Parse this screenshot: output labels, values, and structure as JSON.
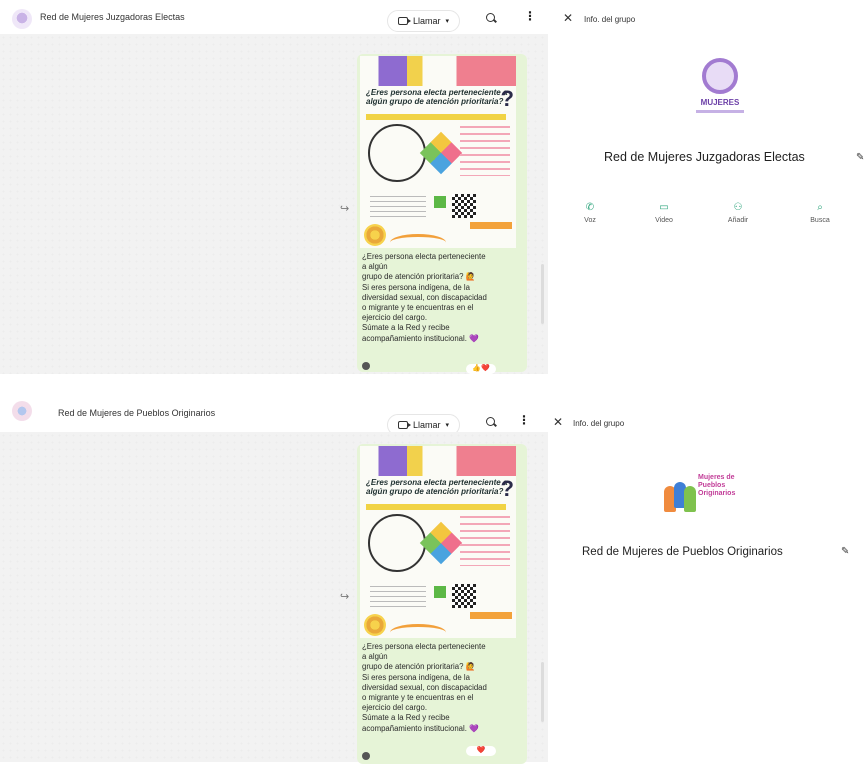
{
  "colors": {
    "accent": "#2aa37a",
    "bubble": "#e6f4d7",
    "chat_bg": "#f2f2f2"
  },
  "screens": [
    {
      "header": {
        "group_name": "Red de Mujeres Juzgadoras Electas",
        "call_label": "Llamar",
        "info_title": "Info. del grupo"
      },
      "message": {
        "poster_title": "¿Eres persona electa perteneciente a algún grupo de atención prioritaria?",
        "text_lines": [
          "¿Eres persona electa perteneciente",
          "a algún",
          "grupo de atención prioritaria? 🙋",
          "Si eres persona indígena, de la",
          "diversidad sexual, con discapacidad",
          "o migrante y te encuentras en el",
          "ejercicio del cargo.",
          "Súmate a la Red y recibe",
          "acompañamiento institucional. 💜"
        ],
        "reactions": "👍❤️"
      },
      "info": {
        "logo_text": "MUJERES",
        "group_name": "Red de Mujeres Juzgadoras Electas",
        "actions": [
          {
            "icon": "phone-icon",
            "label": "Voz"
          },
          {
            "icon": "video-icon",
            "label": "Video"
          },
          {
            "icon": "add-person-icon",
            "label": "Añadir"
          },
          {
            "icon": "search-icon",
            "label": "Busca"
          }
        ]
      }
    },
    {
      "header": {
        "group_name": "Red de Mujeres de Pueblos Originarios",
        "call_label": "Llamar",
        "info_title": "Info. del grupo"
      },
      "message": {
        "poster_title": "¿Eres persona electa perteneciente a algún grupo de atención prioritaria?",
        "text_lines": [
          "¿Eres persona electa perteneciente",
          "a algún",
          "grupo de atención prioritaria? 🙋",
          "Si eres persona indígena, de la",
          "diversidad sexual, con discapacidad",
          "o migrante y te encuentras en el",
          "ejercicio del cargo.",
          "Súmate a la Red y recibe",
          "acompañamiento institucional. 💜"
        ],
        "reactions": "❤️"
      },
      "info": {
        "logo_text": "Mujeres de Pueblos Originarios",
        "group_name": "Red de Mujeres de Pueblos Originarios"
      }
    }
  ]
}
